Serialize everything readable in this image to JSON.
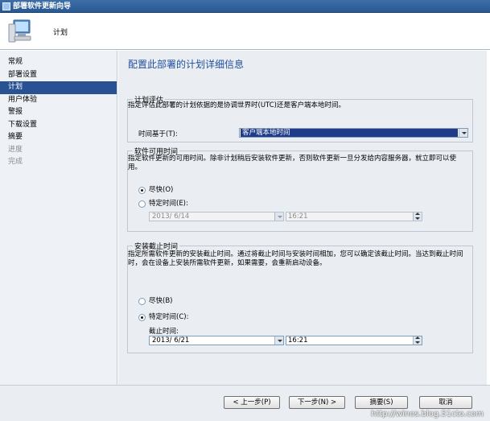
{
  "window": {
    "title": "部署软件更新向导"
  },
  "header": {
    "title": "计划"
  },
  "nav": {
    "items": [
      {
        "label": "常规",
        "state": "normal"
      },
      {
        "label": "部署设置",
        "state": "normal"
      },
      {
        "label": "计划",
        "state": "active"
      },
      {
        "label": "用户体验",
        "state": "normal"
      },
      {
        "label": "警报",
        "state": "normal"
      },
      {
        "label": "下载设置",
        "state": "normal"
      },
      {
        "label": "摘要",
        "state": "normal"
      },
      {
        "label": "进度",
        "state": "disabled"
      },
      {
        "label": "完成",
        "state": "disabled"
      }
    ]
  },
  "main": {
    "page_title": "配置此部署的计划详细信息",
    "schedule_eval": {
      "legend": "计划评估",
      "description": "指定评估此部署的计划依据的是协调世界时(UTC)还是客户端本地时间。",
      "time_based_label": "时间基于(T):",
      "time_based_value": "客户端本地时间"
    },
    "available_time": {
      "legend": "软件可用时间",
      "description": "指定软件更新的可用时间。除非计划稍后安装软件更新，否则软件更新一旦分发给内容服务器，就立即可以使用。",
      "asap_label": "尽快(O)",
      "asap_checked": true,
      "specific_label": "特定时间(E):",
      "specific_checked": false,
      "date": "2013/ 6/14",
      "time": "16:21"
    },
    "deadline": {
      "legend": "安装截止时间",
      "description": "指定所需软件更新的安装截止时间。通过将截止时间与安装时间相加，您可以确定该截止时间。当达到截止时间时，会在设备上安装所需软件更新，如果需要，会重新启动设备。",
      "asap_label": "尽快(B)",
      "asap_checked": false,
      "specific_label": "特定时间(C):",
      "specific_checked": true,
      "deadline_label": "截止时间:",
      "date": "2013/ 6/21",
      "time": "16:21"
    }
  },
  "footer": {
    "back_label": "< 上一步(P)",
    "next_label": "下一步(N) >",
    "summary_label": "摘要(S)",
    "cancel_label": "取消"
  },
  "watermark": "http://winos.blog.51cto.com",
  "colors": {
    "accent": "#2a5193",
    "title_blue": "#1f4e9c",
    "selection": "#1f3c8a"
  }
}
